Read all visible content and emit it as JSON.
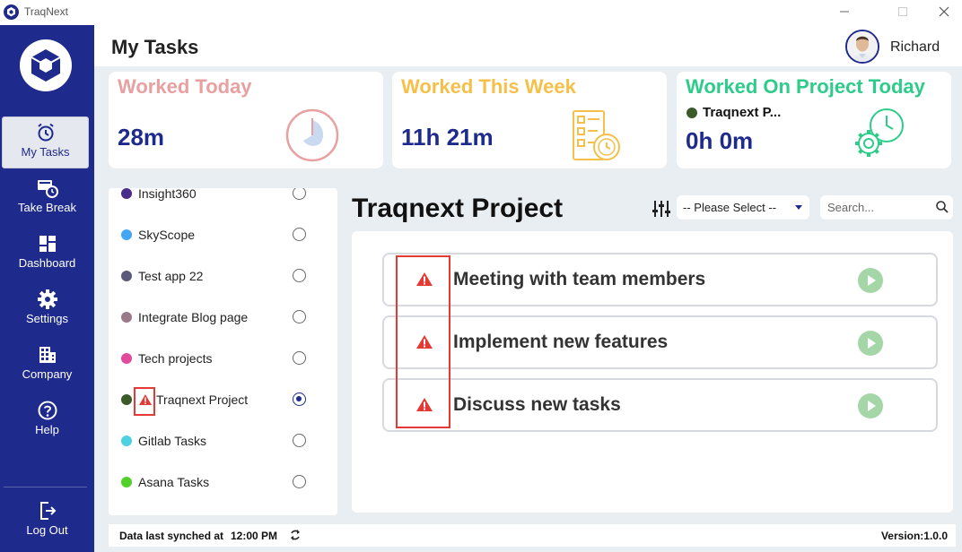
{
  "window": {
    "title": "TraqNext"
  },
  "sidebar": {
    "items": [
      {
        "label": "My Tasks",
        "icon": "alarm-clock-icon",
        "active": true
      },
      {
        "label": "Take Break",
        "icon": "break-timer-icon"
      },
      {
        "label": "Dashboard",
        "icon": "dashboard-grid-icon"
      },
      {
        "label": "Settings",
        "icon": "gear-icon"
      },
      {
        "label": "Company",
        "icon": "building-icon"
      },
      {
        "label": "Help",
        "icon": "question-circle-icon"
      }
    ],
    "logout": {
      "label": "Log Out",
      "icon": "logout-icon"
    }
  },
  "header": {
    "title": "My Tasks",
    "user_name": "Richard"
  },
  "cards": {
    "today": {
      "title": "Worked Today",
      "value": "28m",
      "color": "#e8a0a0"
    },
    "week": {
      "title": "Worked This Week",
      "value": "11h 21m",
      "color": "#f5c04a"
    },
    "project": {
      "title": "Worked On Project Today",
      "project_name": "Traqnext P...",
      "value": "0h 0m",
      "color": "#2ecc8a"
    }
  },
  "projects": [
    {
      "name": "Insight360",
      "dot": "#4a2a8a",
      "selected": false
    },
    {
      "name": "SkyScope",
      "dot": "#42a5f5",
      "selected": false
    },
    {
      "name": "Test app 22",
      "dot": "#5c5a7a",
      "selected": false
    },
    {
      "name": "Integrate Blog page",
      "dot": "#9a7a8a",
      "selected": false
    },
    {
      "name": "Tech projects",
      "dot": "#e04a9a",
      "selected": false
    },
    {
      "name": "Traqnext Project",
      "dot": "#3a5a2a",
      "selected": true,
      "warning": true
    },
    {
      "name": "Gitlab Tasks",
      "dot": "#4dd0e1",
      "selected": false
    },
    {
      "name": "Asana Tasks",
      "dot": "#52d02a",
      "selected": false
    }
  ],
  "task_panel": {
    "project_title": "Traqnext Project",
    "select_value": "-- Please Select --",
    "search_placeholder": "Search...",
    "tasks": [
      {
        "name": "Meeting with team members"
      },
      {
        "name": "Implement new features"
      },
      {
        "name": "Discuss new tasks"
      }
    ]
  },
  "footer": {
    "sync_label": "Data last synched at",
    "sync_time": "12:00 PM",
    "version": "Version:1.0.0"
  },
  "colors": {
    "primary": "#1e2a8c",
    "warning": "#e53935"
  }
}
